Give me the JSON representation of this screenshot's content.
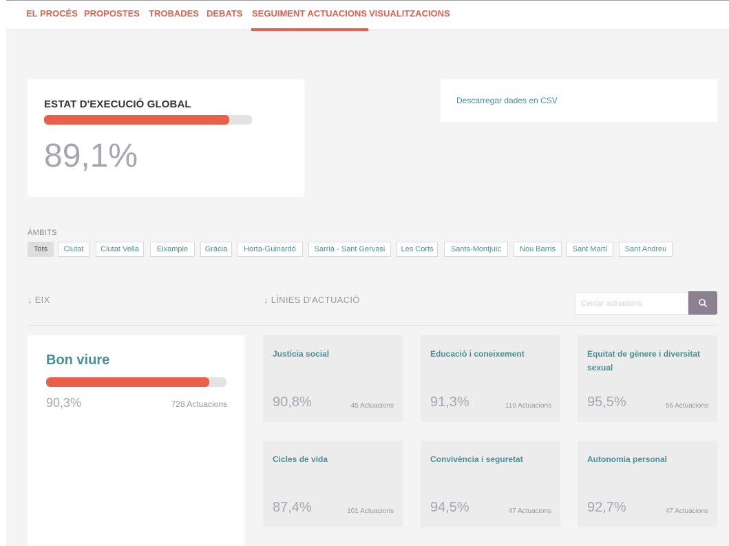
{
  "nav": {
    "items": [
      "EL PROCÉS",
      "PROPOSTES",
      "TROBADES",
      "DEBATS",
      "SEGUIMENT ACTUACIONS",
      "VISUALITZACIONS"
    ],
    "active": "SEGUIMENT ACTUACIONS"
  },
  "global": {
    "title": "ESTAT D'EXECUCIÓ GLOBAL",
    "percent_text": "89,1%",
    "progress": 0.891
  },
  "csv_link": "Descarregar dades en CSV",
  "ambits": {
    "label": "ÀMBITS",
    "filters": [
      "Tots",
      "Ciutat",
      "Ciutat Vella",
      "Eixample",
      "Gràcia",
      "Horta-Guinardó",
      "Sarrià - Sant Gervasi",
      "Les Corts",
      "Sants-Montjuïc",
      "Nou Barris",
      "Sant Martí",
      "Sant Andreu"
    ],
    "active": "Tots"
  },
  "headers": {
    "eix": "↓ EIX",
    "linies": "↓ LÍNIES D'ACTUACIÓ"
  },
  "search": {
    "placeholder": "Cercar actuacions",
    "icon": "search-icon"
  },
  "eix": {
    "title": "Bon viure",
    "percent_text": "90,3%",
    "count": "728 Actuacions",
    "progress": 0.903
  },
  "lines": [
    {
      "title": "Justícia social",
      "percent": "90,8%",
      "count": "45 Actuacions"
    },
    {
      "title": "Educació i coneixement",
      "percent": "91,3%",
      "count": "119 Actuacions"
    },
    {
      "title": "Equitat de gènere i diversitat sexual",
      "percent": "95,5%",
      "count": "56 Actuacions"
    },
    {
      "title": "Cicles de vida",
      "percent": "87,4%",
      "count": "101 Actuacions"
    },
    {
      "title": "Convivència i seguretat",
      "percent": "94,5%",
      "count": "47 Actuacions"
    },
    {
      "title": "Autonomia personal",
      "percent": "92,7%",
      "count": "47 Actuacions"
    }
  ],
  "colors": {
    "accent": "#e8604c",
    "teal": "#4a8f97",
    "muted_purple": "#a9a4b2",
    "search_button": "#8c8190"
  }
}
